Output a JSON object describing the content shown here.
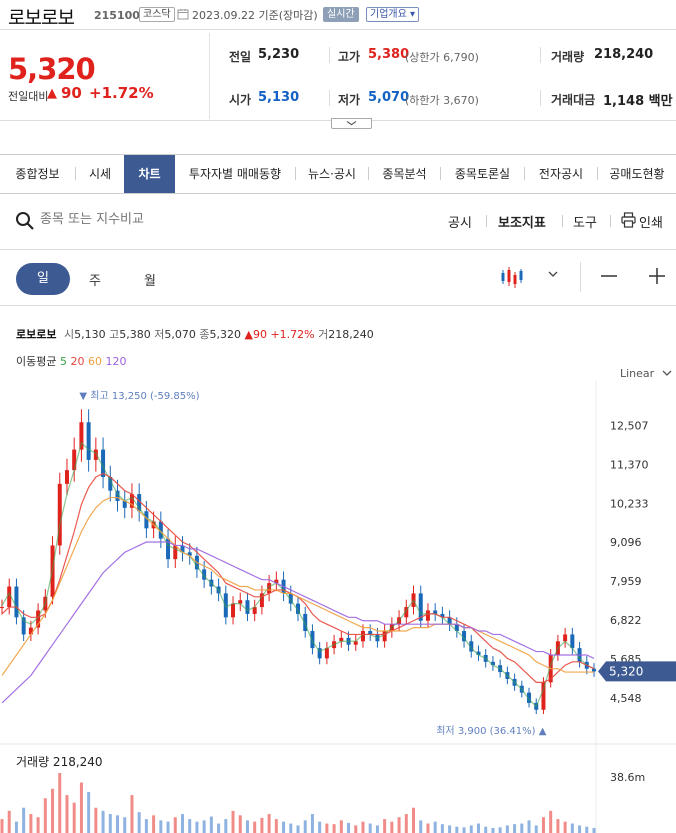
{
  "header": {
    "stock_name": "로보로보",
    "stock_code": "215100",
    "market": "코스닥",
    "date": "2023.09.22 기준(장마감)",
    "realtime": "실시간",
    "company_overview": "기업개요 ▾"
  },
  "price": {
    "current": "5,320",
    "diff_label": "전일대비",
    "diff": "90",
    "diff_pct": "+1.72%"
  },
  "quote": {
    "prev_label": "전일",
    "prev": "5,230",
    "high_label": "고가",
    "high": "5,380",
    "upper_limit": "(상한가 6,790)",
    "volume_label": "거래량",
    "volume": "218,240",
    "open_label": "시가",
    "open": "5,130",
    "low_label": "저가",
    "low": "5,070",
    "lower_limit": "(하한가 3,670)",
    "amount_label": "거래대금",
    "amount": "1,148 백만"
  },
  "tabs": [
    "종합정보",
    "시세",
    "차트",
    "투자자별 매매동향",
    "뉴스·공시",
    "종목분석",
    "종목토론실",
    "전자공시",
    "공매도현황"
  ],
  "search": {
    "placeholder": "종목 또는 지수비교"
  },
  "tools": {
    "disclosure": "공시",
    "indicator": "보조지표",
    "tool": "도구",
    "print": "인쇄"
  },
  "periods": {
    "day": "일",
    "week": "주",
    "month": "월"
  },
  "info": {
    "name": "로보로보",
    "open_label": "시",
    "open": "5,130",
    "high_label": "고",
    "high": "5,380",
    "low_label": "저",
    "low": "5,070",
    "close_label": "종",
    "close": "5,320",
    "diff": "▲90",
    "pct": "+1.72%",
    "vol_label": "거",
    "vol": "218,240"
  },
  "ma": {
    "label": "이동평균",
    "p5": "5",
    "p20": "20",
    "p60": "60",
    "p120": "120"
  },
  "scale": "Linear",
  "colors": {
    "up": "#e0221d",
    "down": "#1a69b8",
    "ma5": "#3aa14a",
    "ma20": "#e8463c",
    "ma60": "#f0a040",
    "ma120": "#9a62e0",
    "accent": "#3d5a93"
  },
  "chart_data": {
    "type": "line",
    "y_ticks": [
      12507,
      11370,
      10233,
      9096,
      7959,
      6822,
      5685,
      4548
    ],
    "y_tick_labels": [
      "12,507",
      "11,370",
      "10,233",
      "9,096",
      "7,959",
      "6,822",
      "5,685",
      "4,548"
    ],
    "ylim": [
      3900,
      13250
    ],
    "max_label": "최고 13,250 (-59.85%)",
    "min_label": "최저 3,900 (36.41%)",
    "current_label": "5,320",
    "close_series": [
      7200,
      7800,
      6900,
      6400,
      6600,
      7100,
      7500,
      9000,
      10800,
      11200,
      11800,
      12600,
      11500,
      11800,
      11000,
      10600,
      10300,
      10100,
      10500,
      10000,
      9500,
      9700,
      9200,
      8600,
      9000,
      8800,
      8700,
      8300,
      8000,
      7800,
      7600,
      6900,
      7300,
      7400,
      7000,
      7200,
      7600,
      7900,
      8000,
      7600,
      7300,
      7000,
      6500,
      6000,
      5700,
      6000,
      6200,
      6300,
      6100,
      6200,
      6500,
      6400,
      6200,
      6500,
      6700,
      6900,
      7200,
      7600,
      6800,
      7100,
      7000,
      6900,
      6700,
      6500,
      6200,
      5900,
      5800,
      5600,
      5500,
      5300,
      5100,
      4900,
      4700,
      4400,
      4200,
      5000,
      5800,
      6200,
      6400,
      6000,
      5600,
      5400,
      5320
    ],
    "series": [
      {
        "name": "5",
        "values": [
          7250,
          7600,
          7200,
          6800,
          6700,
          6900,
          7300,
          8300,
          9600,
          10500,
          11200,
          12000,
          11800,
          11700,
          11300,
          10900,
          10500,
          10300,
          10400,
          10100,
          9800,
          9700,
          9400,
          9000,
          8900,
          8800,
          8700,
          8400,
          8100,
          7900,
          7700,
          7200,
          7300,
          7300,
          7100,
          7200,
          7500,
          7800,
          7900,
          7700,
          7400,
          7100,
          6700,
          6200,
          5900,
          6000,
          6100,
          6200,
          6200,
          6200,
          6400,
          6400,
          6300,
          6400,
          6600,
          6800,
          7100,
          7400,
          7000,
          7000,
          7000,
          6900,
          6700,
          6500,
          6300,
          6000,
          5800,
          5700,
          5500,
          5400,
          5200,
          5000,
          4800,
          4500,
          4300,
          4800,
          5500,
          6000,
          6200,
          6000,
          5700,
          5500,
          5400
        ]
      },
      {
        "name": "20",
        "values": [
          7000,
          7200,
          7200,
          7000,
          6900,
          6900,
          7000,
          7400,
          8000,
          8700,
          9400,
          10200,
          10700,
          11000,
          11100,
          11000,
          10800,
          10600,
          10500,
          10300,
          10100,
          9900,
          9700,
          9500,
          9300,
          9100,
          9000,
          8800,
          8600,
          8400,
          8200,
          7900,
          7800,
          7700,
          7600,
          7500,
          7500,
          7600,
          7700,
          7700,
          7600,
          7500,
          7300,
          7000,
          6800,
          6700,
          6600,
          6500,
          6400,
          6400,
          6400,
          6400,
          6400,
          6400,
          6500,
          6600,
          6700,
          6800,
          6900,
          7000,
          7000,
          6900,
          6900,
          6800,
          6700,
          6600,
          6400,
          6200,
          6000,
          5900,
          5700,
          5600,
          5400,
          5200,
          5000,
          5000,
          5100,
          5300,
          5500,
          5600,
          5600,
          5500,
          5400
        ]
      },
      {
        "name": "60",
        "values": [
          5200,
          5500,
          5800,
          6100,
          6400,
          6700,
          7000,
          7400,
          7900,
          8400,
          8900,
          9400,
          9800,
          10100,
          10300,
          10400,
          10400,
          10300,
          10200,
          10000,
          9800,
          9600,
          9400,
          9200,
          9000,
          8800,
          8700,
          8500,
          8400,
          8300,
          8100,
          8000,
          7900,
          7800,
          7800,
          7700,
          7700,
          7700,
          7700,
          7600,
          7600,
          7500,
          7400,
          7300,
          7200,
          7100,
          7000,
          6900,
          6800,
          6700,
          6600,
          6600,
          6500,
          6500,
          6500,
          6500,
          6500,
          6600,
          6600,
          6600,
          6700,
          6700,
          6700,
          6700,
          6600,
          6600,
          6500,
          6400,
          6300,
          6200,
          6100,
          6000,
          5900,
          5800,
          5600,
          5500,
          5400,
          5400,
          5300,
          5300,
          5300,
          5300,
          5300
        ]
      },
      {
        "name": "120",
        "values": [
          4400,
          4600,
          4800,
          5000,
          5200,
          5500,
          5800,
          6100,
          6400,
          6700,
          7000,
          7300,
          7600,
          7900,
          8200,
          8400,
          8600,
          8800,
          8900,
          9000,
          9100,
          9100,
          9100,
          9100,
          9000,
          9000,
          8900,
          8900,
          8800,
          8700,
          8600,
          8500,
          8400,
          8300,
          8200,
          8100,
          8000,
          8000,
          7900,
          7800,
          7700,
          7600,
          7500,
          7400,
          7300,
          7200,
          7100,
          7000,
          6900,
          6900,
          6800,
          6800,
          6800,
          6700,
          6700,
          6700,
          6700,
          6700,
          6700,
          6700,
          6700,
          6700,
          6700,
          6700,
          6600,
          6600,
          6500,
          6500,
          6400,
          6400,
          6300,
          6200,
          6100,
          6000,
          5900,
          5900,
          5800,
          5800,
          5800,
          5800,
          5800,
          5800,
          5700
        ]
      }
    ],
    "volume_label": "거래량 218,240",
    "volume_tick": "38.6m",
    "volume_series": [
      22,
      35,
      18,
      40,
      30,
      25,
      55,
      70,
      95,
      60,
      48,
      80,
      65,
      40,
      35,
      30,
      28,
      25,
      60,
      33,
      22,
      28,
      20,
      18,
      25,
      30,
      22,
      18,
      20,
      26,
      15,
      22,
      35,
      28,
      20,
      18,
      24,
      30,
      22,
      18,
      15,
      12,
      20,
      30,
      18,
      15,
      14,
      20,
      16,
      12,
      18,
      15,
      12,
      22,
      18,
      25,
      30,
      40,
      20,
      15,
      18,
      14,
      12,
      10,
      9,
      12,
      15,
      10,
      8,
      9,
      12,
      14,
      15,
      20,
      12,
      25,
      35,
      22,
      18,
      15,
      12,
      10,
      8
    ]
  }
}
